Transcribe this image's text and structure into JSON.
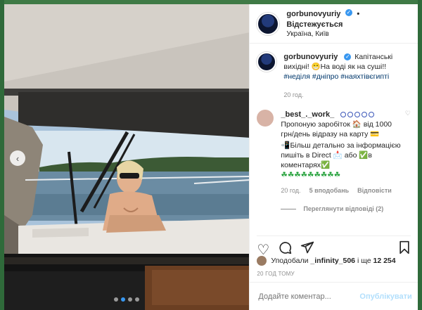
{
  "header": {
    "username": "gorbunovyuriy",
    "separator": "•",
    "follow_status": "Відстежується",
    "location": "Україна, Київ"
  },
  "caption": {
    "username": "gorbunovyuriy",
    "text": "Капітанські вихідні! 😁На воді як на суші!!",
    "hashtags": [
      "#неділя",
      "#дніпро",
      "#наяхтівєгипті"
    ],
    "time": "20 год."
  },
  "comment": {
    "username": "_best_._work_",
    "line1": "Пропоную заробіток 🏠 від 1000 грн/день відразу на карту 💳",
    "line2": "📲Більш детально за інформацією пишіть в Direct 📩 або ✅в коментарях✅",
    "line3": "☘☘☘☘☘☘☘☘☘",
    "time": "20 год.",
    "likes": "5 вподобань",
    "reply": "Відповісти",
    "view_replies": "Переглянути відповіді (2)"
  },
  "likes": {
    "prefix": "Уподобали",
    "user": "_infinity_506",
    "suffix": "і ще",
    "count": "12 254"
  },
  "post_time": "20 год тому",
  "add_comment": {
    "placeholder": "Додайте коментар...",
    "publish": "Опублікувати"
  },
  "carousel": {
    "dots": 4,
    "active_index": 1
  },
  "colors": {
    "accent": "#3897f0",
    "link": "#00376b",
    "muted": "#8e8e8e",
    "publish_disabled": "#b2dffc"
  },
  "icons": [
    "verified-icon",
    "heart-icon",
    "comment-icon",
    "share-icon",
    "bookmark-icon",
    "chevron-left-icon"
  ]
}
